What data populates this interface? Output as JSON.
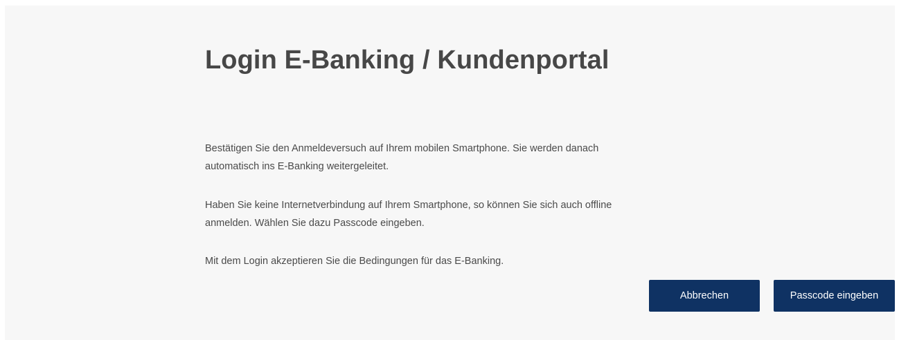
{
  "login": {
    "title": "Login E-Banking / Kundenportal",
    "paragraph1_line1": "Bestätigen Sie den Anmeldeversuch auf Ihrem mobilen Smartphone. Sie werden danach",
    "paragraph1_line2": "automatisch ins E-Banking weitergeleitet.",
    "paragraph2_line1": "Haben Sie keine Internetverbindung auf Ihrem Smartphone, so können Sie sich auch offline",
    "paragraph2_line2": "anmelden. Wählen Sie dazu Passcode eingeben.",
    "paragraph3": "Mit dem Login akzeptieren Sie die Bedingungen für das E-Banking."
  },
  "buttons": {
    "cancel_label": "Abbrechen",
    "passcode_label": "Passcode eingeben"
  },
  "colors": {
    "panel_background": "#f7f7f7",
    "title_text": "#474747",
    "body_text": "#4a4a4a",
    "button_background": "#0f3263",
    "button_text": "#ffffff"
  }
}
